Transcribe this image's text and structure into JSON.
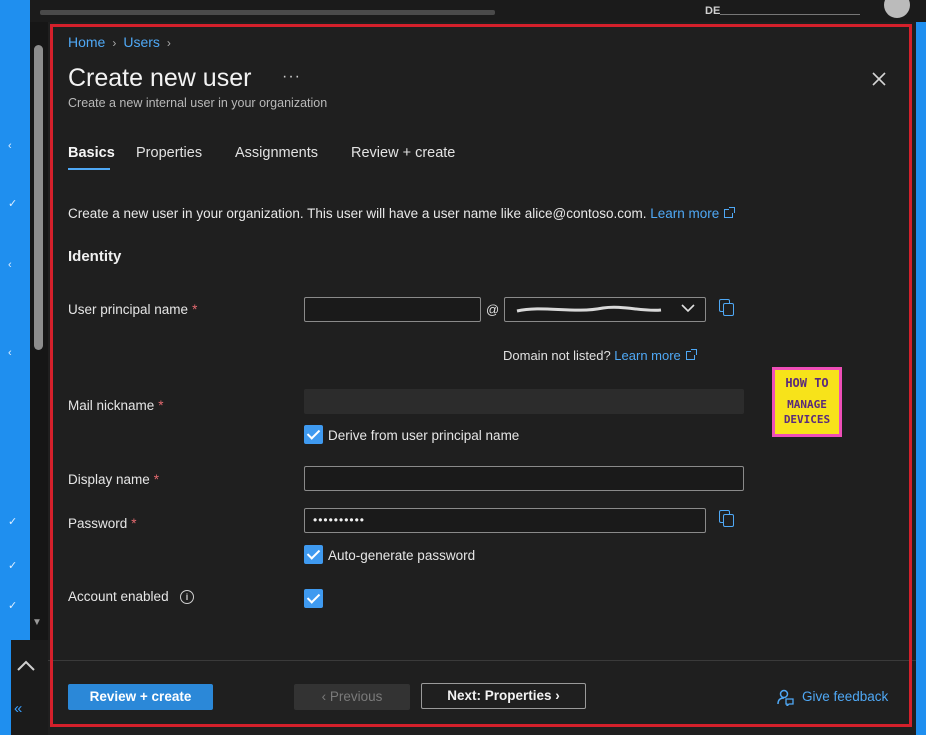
{
  "top_bar": {
    "corner_text": "DE"
  },
  "breadcrumb": {
    "home": "Home",
    "users": "Users",
    "separator": "›"
  },
  "header": {
    "title": "Create new user",
    "more": "···",
    "subtitle": "Create a new internal user in your organization",
    "close": "✕"
  },
  "tabs": [
    {
      "label": "Basics",
      "active": true
    },
    {
      "label": "Properties",
      "active": false
    },
    {
      "label": "Assignments",
      "active": false
    },
    {
      "label": "Review + create",
      "active": false
    }
  ],
  "intro": {
    "text": "Create a new user in your organization. This user will have a user name like alice@contoso.com.",
    "link": "Learn more"
  },
  "section": {
    "identity": "Identity"
  },
  "form": {
    "upn": {
      "label": "User principal name",
      "required_mark": "*",
      "value": "",
      "at": "@",
      "domain_value": "",
      "domain_chevron": "⌄"
    },
    "domain_note": {
      "text": "Domain not listed?",
      "link": "Learn more"
    },
    "mail_nickname": {
      "label": "Mail nickname",
      "required_mark": "*",
      "value": ""
    },
    "derive": {
      "label": "Derive from user principal name",
      "checked": true
    },
    "display_name": {
      "label": "Display name",
      "required_mark": "*",
      "value": ""
    },
    "password": {
      "label": "Password",
      "required_mark": "*",
      "value": "••••••••••"
    },
    "auto_generate": {
      "label": "Auto-generate password",
      "checked": true
    },
    "account_enabled": {
      "label": "Account enabled",
      "info": "i",
      "checked": true
    }
  },
  "logo": {
    "line1": "HOW TO",
    "line2": "MANAGE",
    "line3": "DEVICES"
  },
  "footer": {
    "review_create": "Review + create",
    "previous": "‹  Previous",
    "next": "Next: Properties  ›",
    "feedback": "Give feedback"
  },
  "left_rail": {
    "collapse": "«",
    "chevron_up": "⌃"
  },
  "colors": {
    "accent": "#4fa8f5",
    "primary_button": "#2b88d8",
    "highlight_outline": "#d4202b",
    "background": "#1f1f1f"
  }
}
